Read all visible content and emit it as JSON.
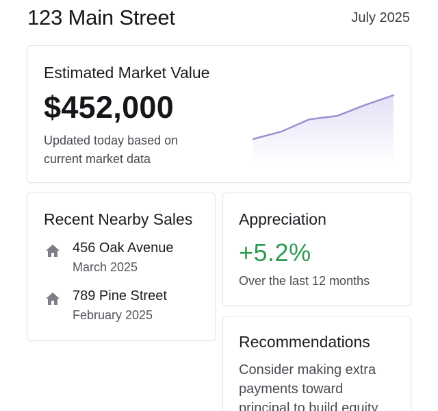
{
  "header": {
    "title": "123 Main Street",
    "date": "July 2025"
  },
  "market_value": {
    "title": "Estimated Market Value",
    "amount": "$452,000",
    "note": "Updated today based on current market data",
    "trend": [
      0,
      0.17,
      0.45,
      0.53,
      0.78,
      1.0
    ],
    "line_color": "#9d8fd0"
  },
  "nearby_sales": {
    "title": "Recent Nearby Sales",
    "items": [
      {
        "address": "456 Oak Avenue",
        "date": "March 2025",
        "icon": "house-icon"
      },
      {
        "address": "789 Pine Street",
        "date": "February 2025",
        "icon": "house-icon"
      }
    ]
  },
  "appreciation": {
    "title": "Appreciation",
    "value": "+5.2%",
    "note": "Over the last 12 months",
    "color": "#2e9a4f"
  },
  "recommendations": {
    "title": "Recommendations",
    "text": "Consider making extra payments toward principal to build equity"
  }
}
